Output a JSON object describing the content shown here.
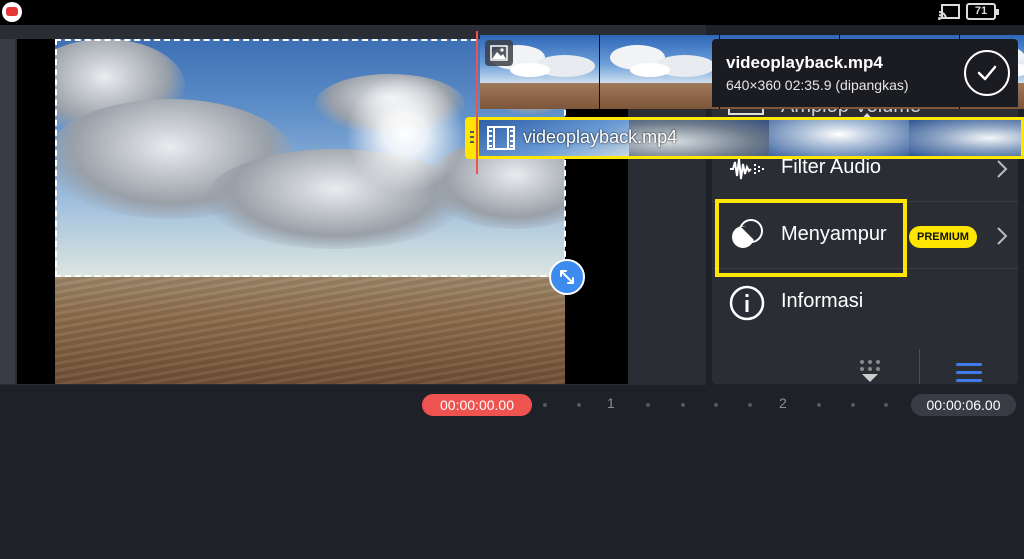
{
  "status_bar": {
    "battery_level": "71"
  },
  "clip_info": {
    "file_name": "videoplayback.mp4",
    "meta": "640×360  02:35.9 (dipangkas)"
  },
  "panel": {
    "partial_item": {
      "label": "Amplop Volume",
      "icon": "volume-envelope-icon"
    },
    "items": [
      {
        "label": "Filter Audio",
        "icon": "audio-filter-icon"
      },
      {
        "label": "Menyampur",
        "icon": "blend-icon",
        "badge": "PREMIUM",
        "highlighted": true
      },
      {
        "label": "Informasi",
        "icon": "info-icon"
      }
    ]
  },
  "timeline": {
    "start_time": "00:00:00.00",
    "end_time": "00:00:06.00",
    "ruler_marks": [
      "1",
      "2"
    ]
  },
  "tracks": {
    "video_label": "videoplayback.mp4"
  },
  "colors": {
    "accent": "#ffe600",
    "playhead": "#ef5350",
    "resize_handle": "#3d8bef"
  }
}
